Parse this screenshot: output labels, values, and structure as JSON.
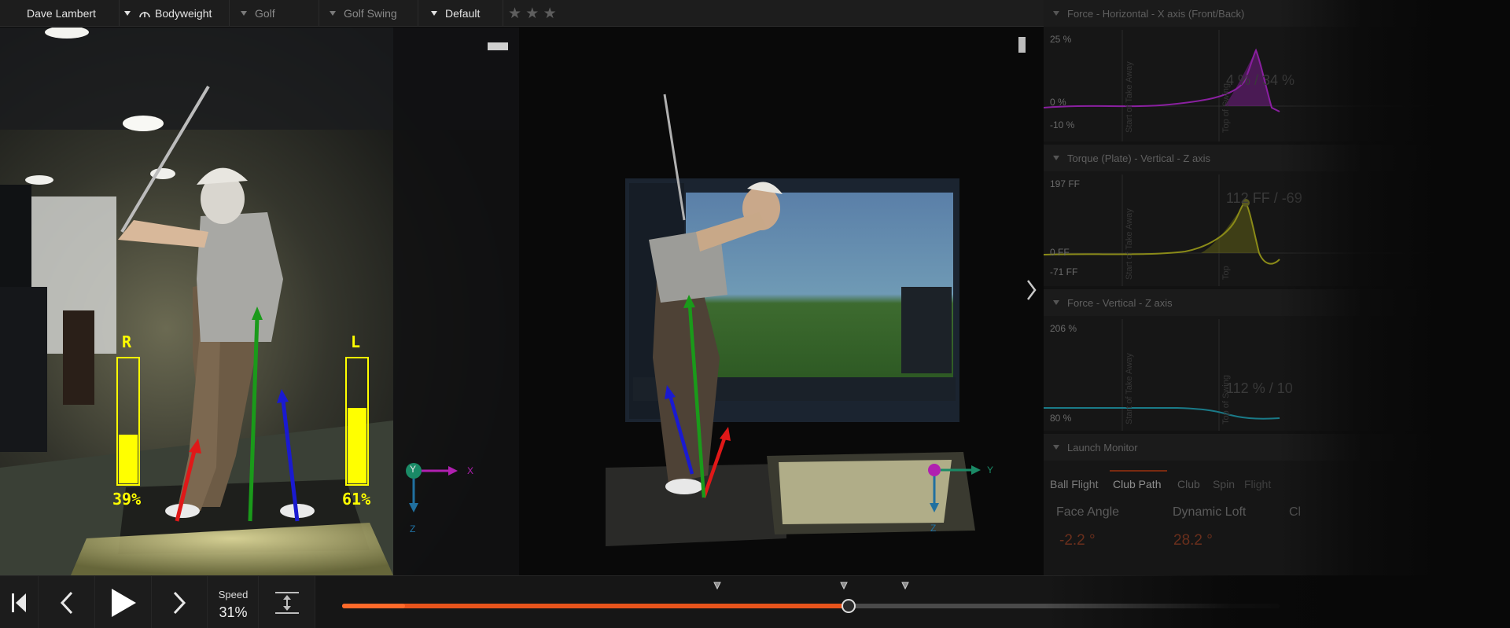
{
  "toolbar": {
    "athlete": "Dave Lambert",
    "mode": "Bodyweight",
    "sport": "Golf",
    "movement": "Golf Swing",
    "layout": "Default",
    "rating_stars": "★ ★ ★"
  },
  "video": {
    "left_bar_label": "R",
    "left_bar_value": "39%",
    "left_bar_fill": 0.39,
    "right_bar_label": "L",
    "right_bar_value": "61%",
    "right_bar_fill": 0.61,
    "left_axes": {
      "y": "Y",
      "x": "X",
      "z": "Z"
    },
    "right_axes": {
      "y": "Y",
      "z": "Z"
    }
  },
  "panels": [
    {
      "title": "Force - Horizontal - X axis (Front/Back)",
      "y_top": "25 %",
      "y_mid": "0 %",
      "y_bottom": "-10 %",
      "marker_label": "Start of Take Away",
      "marker_label_2": "Top of Swing",
      "readout": "4 % / 34 %",
      "color": "#a020c0"
    },
    {
      "title": "Torque (Plate) - Vertical - Z axis",
      "y_top": "197 FF",
      "y_mid": "0 FF",
      "y_bottom": "-71 FF",
      "marker_label": "Start of Take Away",
      "marker_label_2": "Top",
      "readout": "112 FF / -69",
      "color": "#a0a020"
    },
    {
      "title": "Force - Vertical - Z axis",
      "y_top": "206 %",
      "y_mid": "80 %",
      "marker_label": "Start of Take Away",
      "marker_label_2": "Top of Swing",
      "readout": "112 % / 10",
      "color": "#20a0b0"
    }
  ],
  "launch_monitor": {
    "title": "Launch Monitor",
    "tabs": [
      "Ball Flight",
      "Club Path",
      "Club",
      "Spin",
      "Flight"
    ],
    "active_tab": "Club Path",
    "metrics": [
      {
        "label": "Face Angle",
        "value": "-2.2 °"
      },
      {
        "label": "Dynamic Loft",
        "value": "28.2 °"
      },
      {
        "label": "Cl",
        "value": ""
      }
    ]
  },
  "playback": {
    "speed_label": "Speed",
    "speed_value": "31%",
    "progress": 0.54
  },
  "colors": {
    "accent": "#e8541c",
    "force_bar": "#ffff00",
    "arrow_red": "#e01818",
    "arrow_green": "#1a9a1a",
    "arrow_blue": "#1a1ad0"
  }
}
